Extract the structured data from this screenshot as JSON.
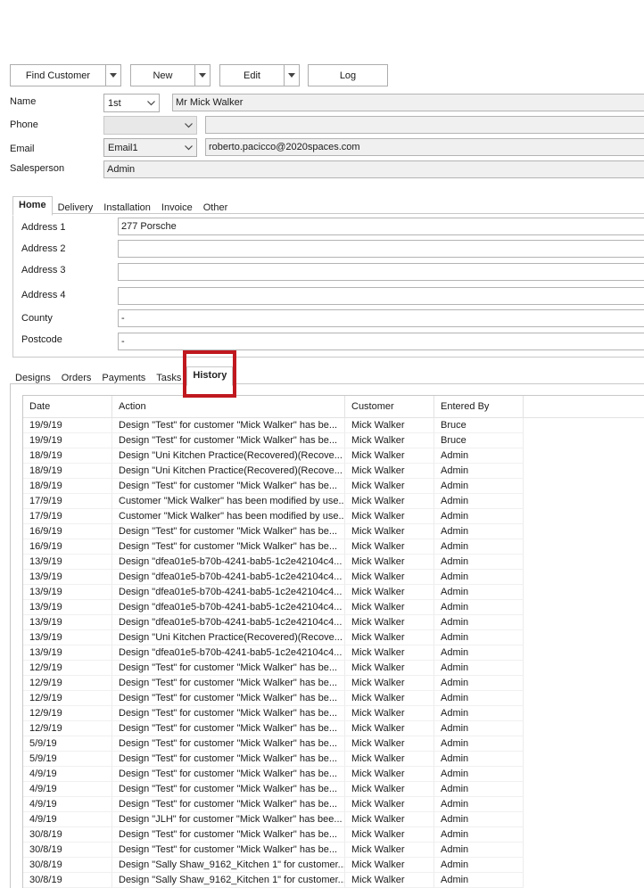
{
  "toolbar": {
    "find_customer": "Find Customer",
    "new": "New",
    "edit": "Edit",
    "log": "Log"
  },
  "form": {
    "name_label": "Name",
    "name_ordinal": "1st",
    "name_value": "Mr Mick Walker",
    "phone_label": "Phone",
    "phone_type": "",
    "phone_value": "",
    "email_label": "Email",
    "email_type": "Email1",
    "email_value": "roberto.pacicco@2020spaces.com",
    "salesperson_label": "Salesperson",
    "salesperson_value": "Admin"
  },
  "address_tabs": [
    "Home",
    "Delivery",
    "Installation",
    "Invoice",
    "Other"
  ],
  "address": {
    "labels": [
      "Address 1",
      "Address 2",
      "Address 3",
      "Address 4",
      "County",
      "Postcode"
    ],
    "values": [
      "277 Porsche",
      "",
      "",
      "",
      "-",
      "-"
    ]
  },
  "lower_tabs": [
    "Designs",
    "Orders",
    "Payments",
    "Tasks",
    "History"
  ],
  "history": {
    "columns": [
      "Date",
      "Action",
      "Customer",
      "Entered By"
    ],
    "rows": [
      [
        "19/9/19",
        "Design \"Test\" for customer \"Mick Walker\" has be...",
        "Mick Walker",
        "Bruce"
      ],
      [
        "19/9/19",
        "Design \"Test\" for customer \"Mick Walker\" has be...",
        "Mick Walker",
        "Bruce"
      ],
      [
        "18/9/19",
        "Design \"Uni Kitchen Practice(Recovered)(Recove...",
        "Mick Walker",
        "Admin"
      ],
      [
        "18/9/19",
        "Design \"Uni Kitchen Practice(Recovered)(Recove...",
        "Mick Walker",
        "Admin"
      ],
      [
        "18/9/19",
        "Design \"Test\" for customer \"Mick Walker\" has be...",
        "Mick Walker",
        "Admin"
      ],
      [
        "17/9/19",
        "Customer \"Mick Walker\" has been modified by use...",
        "Mick Walker",
        "Admin"
      ],
      [
        "17/9/19",
        "Customer \"Mick Walker\" has been modified by use...",
        "Mick Walker",
        "Admin"
      ],
      [
        "16/9/19",
        "Design \"Test\" for customer \"Mick Walker\" has be...",
        "Mick Walker",
        "Admin"
      ],
      [
        "16/9/19",
        "Design \"Test\" for customer \"Mick Walker\" has be...",
        "Mick Walker",
        "Admin"
      ],
      [
        "13/9/19",
        "Design \"dfea01e5-b70b-4241-bab5-1c2e42104c4...",
        "Mick Walker",
        "Admin"
      ],
      [
        "13/9/19",
        "Design \"dfea01e5-b70b-4241-bab5-1c2e42104c4...",
        "Mick Walker",
        "Admin"
      ],
      [
        "13/9/19",
        "Design \"dfea01e5-b70b-4241-bab5-1c2e42104c4...",
        "Mick Walker",
        "Admin"
      ],
      [
        "13/9/19",
        "Design \"dfea01e5-b70b-4241-bab5-1c2e42104c4...",
        "Mick Walker",
        "Admin"
      ],
      [
        "13/9/19",
        "Design \"dfea01e5-b70b-4241-bab5-1c2e42104c4...",
        "Mick Walker",
        "Admin"
      ],
      [
        "13/9/19",
        "Design \"Uni Kitchen Practice(Recovered)(Recove...",
        "Mick Walker",
        "Admin"
      ],
      [
        "13/9/19",
        "Design \"dfea01e5-b70b-4241-bab5-1c2e42104c4...",
        "Mick Walker",
        "Admin"
      ],
      [
        "12/9/19",
        "Design \"Test\" for customer \"Mick Walker\" has be...",
        "Mick Walker",
        "Admin"
      ],
      [
        "12/9/19",
        "Design \"Test\" for customer \"Mick Walker\" has be...",
        "Mick Walker",
        "Admin"
      ],
      [
        "12/9/19",
        "Design \"Test\" for customer \"Mick Walker\" has be...",
        "Mick Walker",
        "Admin"
      ],
      [
        "12/9/19",
        "Design \"Test\" for customer \"Mick Walker\" has be...",
        "Mick Walker",
        "Admin"
      ],
      [
        "12/9/19",
        "Design \"Test\" for customer \"Mick Walker\" has be...",
        "Mick Walker",
        "Admin"
      ],
      [
        "5/9/19",
        "Design \"Test\" for customer \"Mick Walker\" has be...",
        "Mick Walker",
        "Admin"
      ],
      [
        "5/9/19",
        "Design \"Test\" for customer \"Mick Walker\" has be...",
        "Mick Walker",
        "Admin"
      ],
      [
        "4/9/19",
        "Design \"Test\" for customer \"Mick Walker\" has be...",
        "Mick Walker",
        "Admin"
      ],
      [
        "4/9/19",
        "Design \"Test\" for customer \"Mick Walker\" has be...",
        "Mick Walker",
        "Admin"
      ],
      [
        "4/9/19",
        "Design \"Test\" for customer \"Mick Walker\" has be...",
        "Mick Walker",
        "Admin"
      ],
      [
        "4/9/19",
        "Design \"JLH\" for customer \"Mick Walker\" has bee...",
        "Mick Walker",
        "Admin"
      ],
      [
        "30/8/19",
        "Design \"Test\" for customer \"Mick Walker\" has be...",
        "Mick Walker",
        "Admin"
      ],
      [
        "30/8/19",
        "Design \"Test\" for customer \"Mick Walker\" has be...",
        "Mick Walker",
        "Admin"
      ],
      [
        "30/8/19",
        "Design \"Sally Shaw_9162_Kitchen 1\" for customer...",
        "Mick Walker",
        "Admin"
      ],
      [
        "30/8/19",
        "Design \"Sally Shaw_9162_Kitchen 1\" for customer...",
        "Mick Walker",
        "Admin"
      ]
    ]
  },
  "colors": {
    "highlight": "#c0181f"
  }
}
